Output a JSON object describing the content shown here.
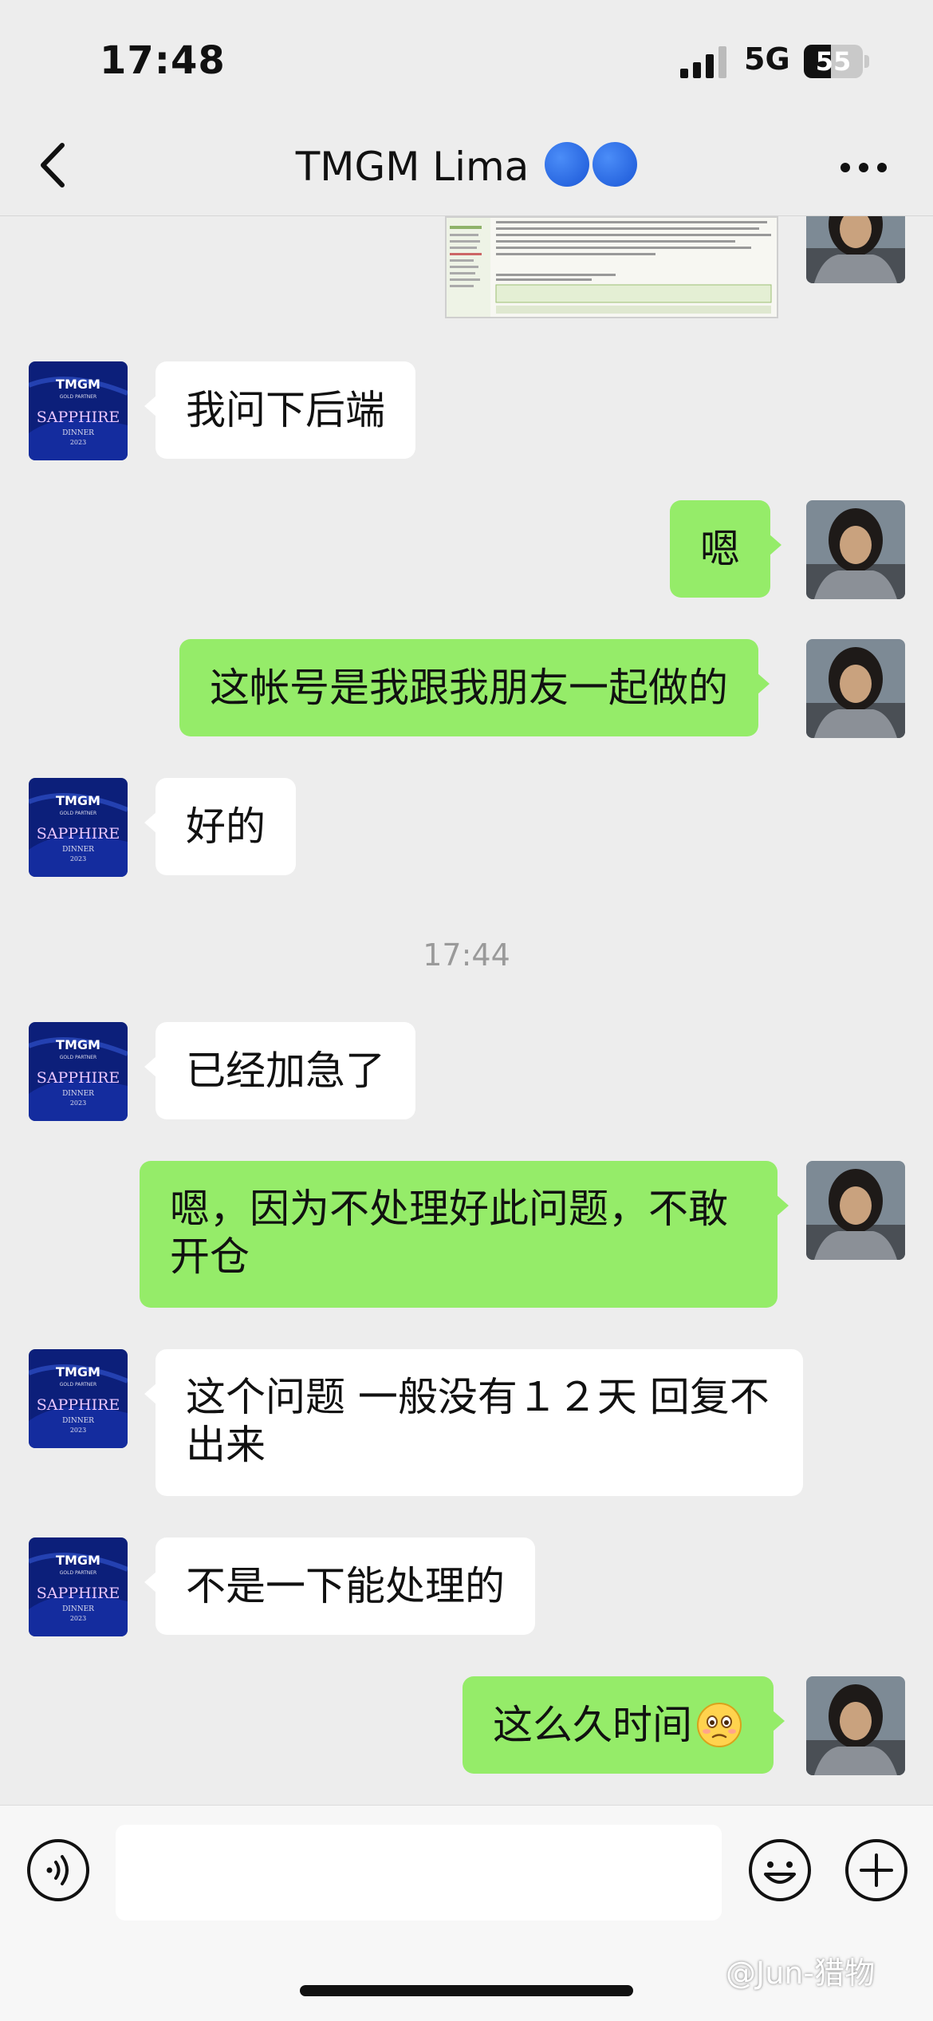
{
  "status_bar": {
    "time": "17:48",
    "network": "5G",
    "battery": "55"
  },
  "header": {
    "title": "TMGM Lima"
  },
  "messages": [
    {
      "side": "in",
      "text": "我问下后端"
    },
    {
      "side": "out",
      "text": "嗯"
    },
    {
      "side": "out",
      "text": "这帐号是我跟我朋友一起做的"
    },
    {
      "side": "in",
      "text": "好的"
    },
    {
      "timestamp": "17:44"
    },
    {
      "side": "in",
      "text": "已经加急了"
    },
    {
      "side": "out",
      "text": "嗯，因为不处理好此问题，不敢\n开仓"
    },
    {
      "side": "in",
      "text": "这个问题 一般没有１２天  回复不\n出来"
    },
    {
      "side": "in",
      "text": "不是一下能处理的"
    },
    {
      "side": "out",
      "text": "这么久时间",
      "emoji": "worried-face"
    }
  ],
  "avatar_logo": {
    "brand": "TMGM",
    "sub": "GOLD PARTNER",
    "title": "SAPPHIRE",
    "event": "DINNER",
    "year": "2023"
  },
  "input": {
    "placeholder": ""
  },
  "watermark": "@Jun-猎物",
  "colors": {
    "out_bubble": "#95ec69",
    "in_bubble": "#ffffff",
    "background": "#ededed"
  }
}
